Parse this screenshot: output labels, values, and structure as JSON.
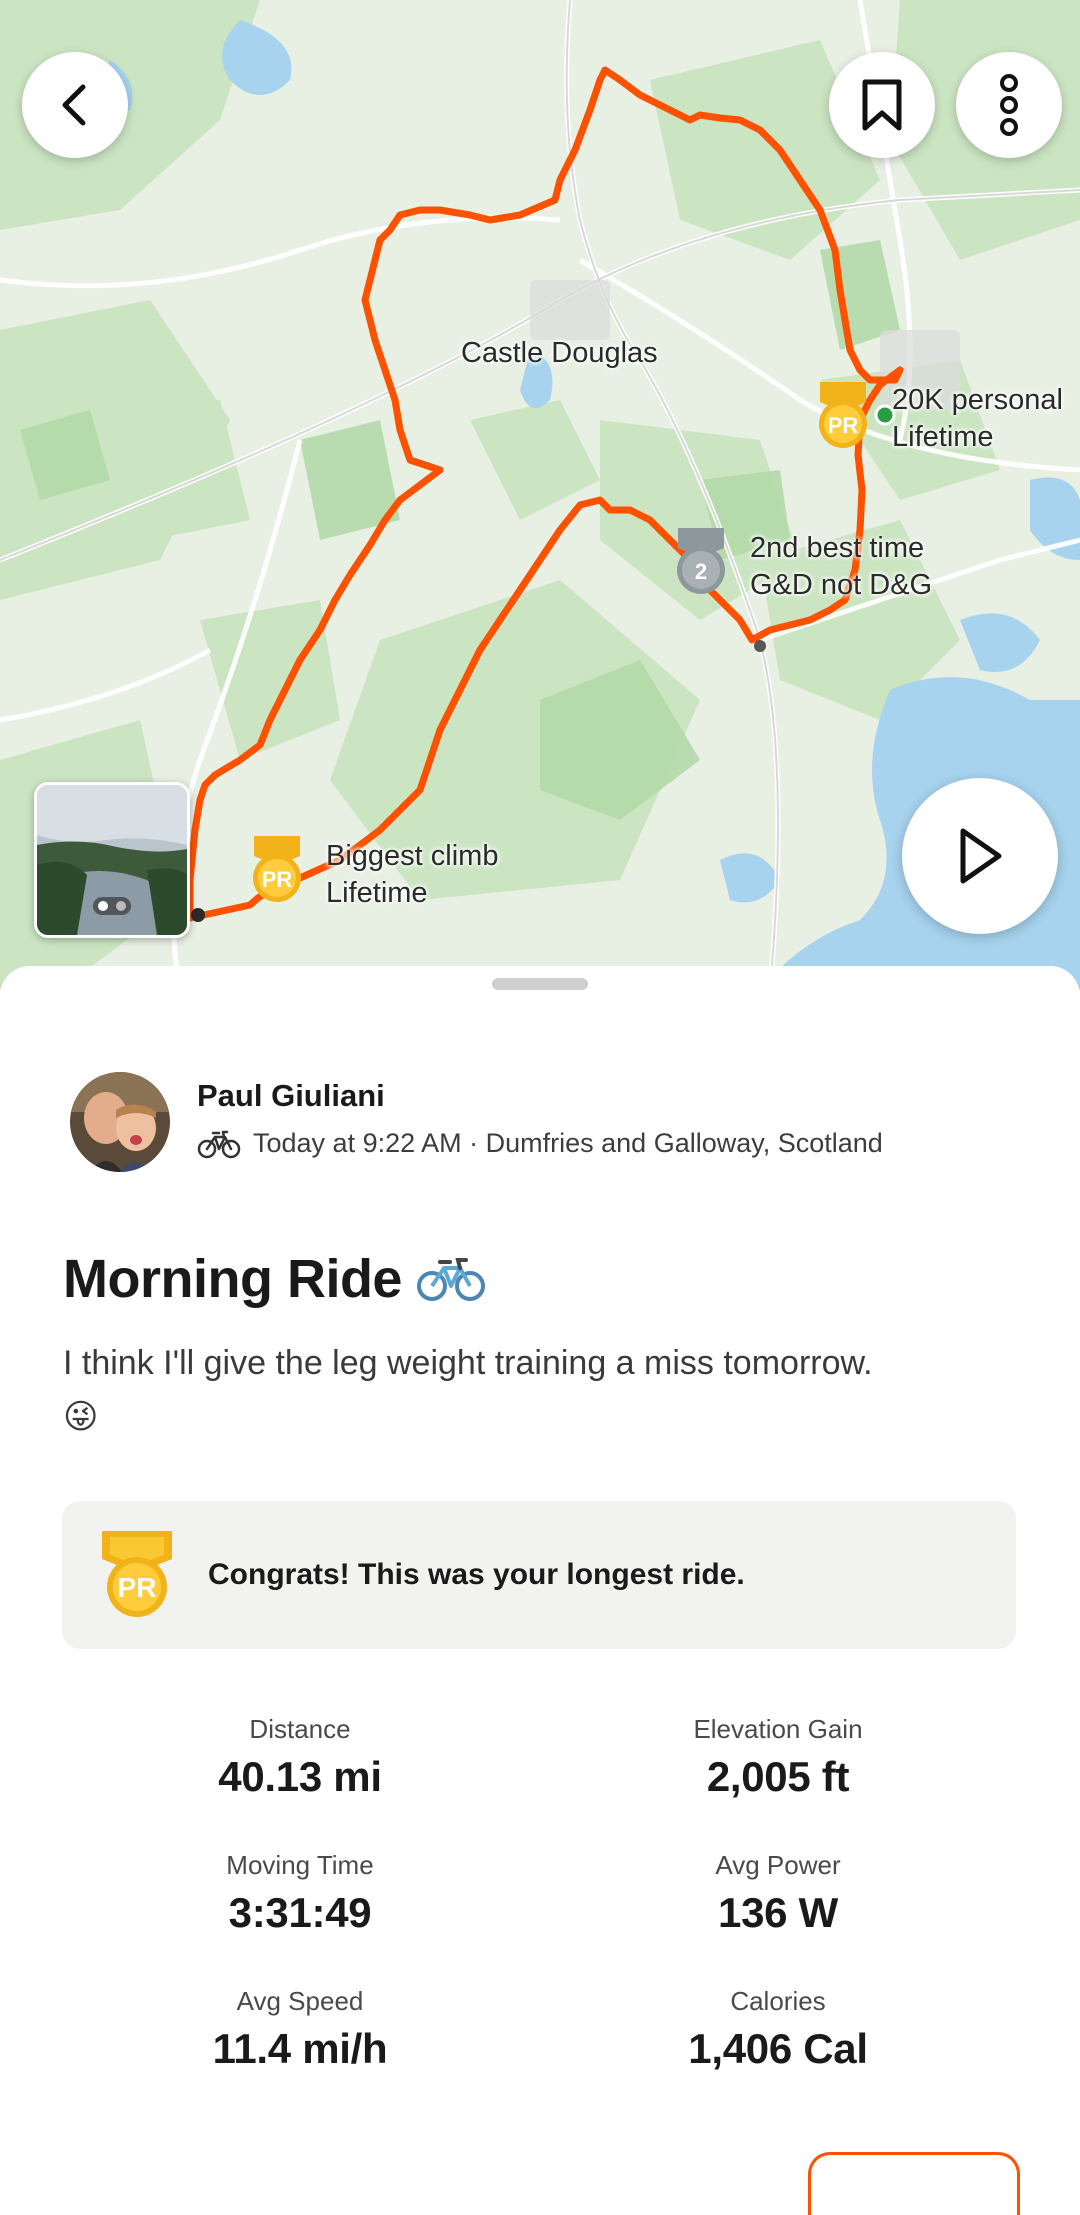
{
  "map": {
    "place_label": "Castle Douglas",
    "annotations": [
      {
        "line1": "20K personal",
        "line2": "Lifetime",
        "badge": "PR"
      },
      {
        "line1": "2nd best time",
        "line2": "G&D not D&G",
        "badge": "2"
      },
      {
        "line1": "Biggest climb",
        "line2": "Lifetime",
        "badge": "PR"
      }
    ],
    "buttons": {
      "back_icon": "chevron-left-icon",
      "bookmark_icon": "bookmark-icon",
      "more_icon": "more-vertical-icon",
      "replay_icon": "play-icon"
    },
    "route_color": "#fc5200"
  },
  "activity": {
    "athlete": "Paul Giuliani",
    "meta": "Today at 9:22 AM · Dumfries and Galloway, Scotland",
    "title": "Morning Ride",
    "description": "I think I'll give the leg weight training a miss tomorrow.",
    "description_emoji": "😜",
    "pr_banner": "Congrats! This was your longest ride.",
    "stats": [
      {
        "label": "Distance",
        "value": "40.13 mi"
      },
      {
        "label": "Elevation Gain",
        "value": "2,005 ft"
      },
      {
        "label": "Moving Time",
        "value": "3:31:49"
      },
      {
        "label": "Avg Power",
        "value": "136 W"
      },
      {
        "label": "Avg Speed",
        "value": "11.4 mi/h"
      },
      {
        "label": "Calories",
        "value": "1,406 Cal"
      }
    ]
  },
  "colors": {
    "accent": "#fc5200",
    "pr_gold": "#f2b21a",
    "silver": "#8e979c"
  }
}
